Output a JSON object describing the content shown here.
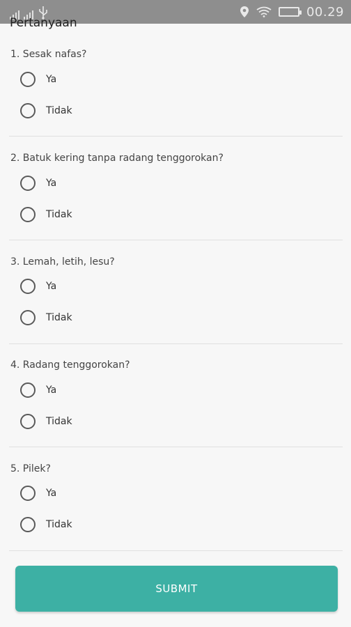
{
  "status_bar": {
    "time": "00.29",
    "icons": [
      "signal-icon",
      "usb-icon",
      "location-icon",
      "wifi-icon",
      "battery-icon"
    ]
  },
  "page": {
    "title": "Pertanyaan"
  },
  "questions": [
    {
      "text": "1. Sesak nafas?",
      "options": [
        "Ya",
        "Tidak"
      ]
    },
    {
      "text": "2. Batuk kering tanpa radang tenggorokan?",
      "options": [
        "Ya",
        "Tidak"
      ]
    },
    {
      "text": "3. Lemah, letih,  lesu?",
      "options": [
        "Ya",
        "Tidak"
      ]
    },
    {
      "text": "4. Radang tenggorokan?",
      "options": [
        "Ya",
        "Tidak"
      ]
    },
    {
      "text": "5. Pilek?",
      "options": [
        "Ya",
        "Tidak"
      ]
    }
  ],
  "submit_label": "SUBMIT",
  "colors": {
    "accent": "#3db0a4",
    "status_bar": "#8e8e8e",
    "background": "#f7f7f7"
  }
}
